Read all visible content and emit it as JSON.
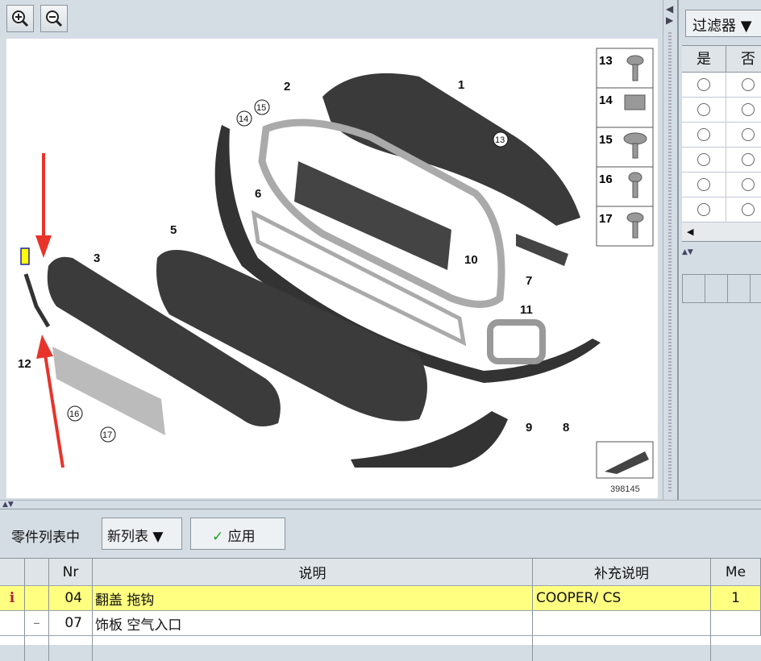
{
  "toolbar": {
    "zoom_in": "zoom-in",
    "zoom_out": "zoom-out"
  },
  "diagram": {
    "labels": [
      "1",
      "2",
      "3",
      "5",
      "6",
      "7",
      "8",
      "9",
      "10",
      "11",
      "12"
    ],
    "circled": [
      "13",
      "14",
      "15",
      "16",
      "17"
    ],
    "legend": [
      "13",
      "14",
      "15",
      "16",
      "17"
    ],
    "image_number": "398145"
  },
  "filter": {
    "label": "过滤器",
    "cols": [
      "是",
      "否"
    ],
    "rows": 6
  },
  "bottom": {
    "list_label": "零件列表中",
    "list_select": "新列表",
    "apply_label": "应用",
    "headers": {
      "nr": "Nr",
      "desc": "说明",
      "extra": "补充说明",
      "me": "Me"
    },
    "rows": [
      {
        "icon": "i",
        "mark": "",
        "nr": "04",
        "desc": "翻盖 拖钩",
        "extra": "COOPER/ CS",
        "me": "1",
        "highlight": true
      },
      {
        "icon": "",
        "mark": "–",
        "nr": "07",
        "desc": "饰板 空气入口",
        "extra": "",
        "me": "",
        "highlight": false
      }
    ]
  },
  "colors": {
    "highlight": "#ffff80",
    "check": "#1aa31a",
    "arrow": "#e8332a",
    "info": "#b0203a"
  }
}
